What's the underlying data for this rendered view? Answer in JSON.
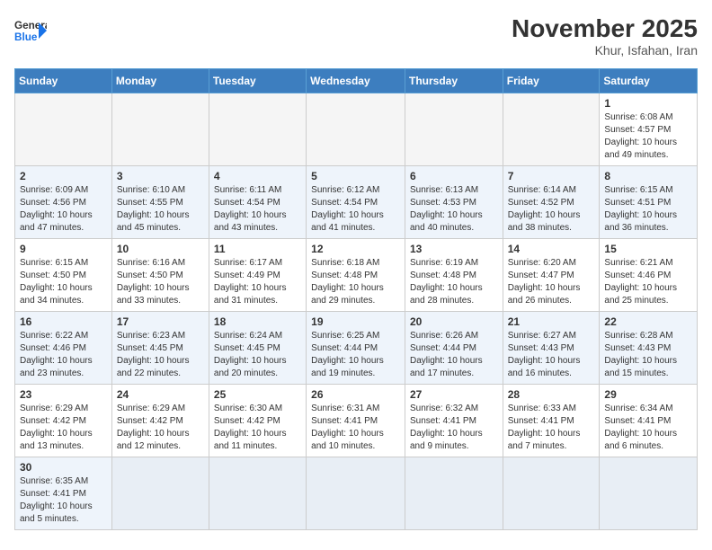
{
  "header": {
    "logo_general": "General",
    "logo_blue": "Blue",
    "month_year": "November 2025",
    "location": "Khur, Isfahan, Iran"
  },
  "days_of_week": [
    "Sunday",
    "Monday",
    "Tuesday",
    "Wednesday",
    "Thursday",
    "Friday",
    "Saturday"
  ],
  "weeks": [
    [
      {
        "day": "",
        "info": ""
      },
      {
        "day": "",
        "info": ""
      },
      {
        "day": "",
        "info": ""
      },
      {
        "day": "",
        "info": ""
      },
      {
        "day": "",
        "info": ""
      },
      {
        "day": "",
        "info": ""
      },
      {
        "day": "1",
        "info": "Sunrise: 6:08 AM\nSunset: 4:57 PM\nDaylight: 10 hours and 49 minutes."
      }
    ],
    [
      {
        "day": "2",
        "info": "Sunrise: 6:09 AM\nSunset: 4:56 PM\nDaylight: 10 hours and 47 minutes."
      },
      {
        "day": "3",
        "info": "Sunrise: 6:10 AM\nSunset: 4:55 PM\nDaylight: 10 hours and 45 minutes."
      },
      {
        "day": "4",
        "info": "Sunrise: 6:11 AM\nSunset: 4:54 PM\nDaylight: 10 hours and 43 minutes."
      },
      {
        "day": "5",
        "info": "Sunrise: 6:12 AM\nSunset: 4:54 PM\nDaylight: 10 hours and 41 minutes."
      },
      {
        "day": "6",
        "info": "Sunrise: 6:13 AM\nSunset: 4:53 PM\nDaylight: 10 hours and 40 minutes."
      },
      {
        "day": "7",
        "info": "Sunrise: 6:14 AM\nSunset: 4:52 PM\nDaylight: 10 hours and 38 minutes."
      },
      {
        "day": "8",
        "info": "Sunrise: 6:15 AM\nSunset: 4:51 PM\nDaylight: 10 hours and 36 minutes."
      }
    ],
    [
      {
        "day": "9",
        "info": "Sunrise: 6:15 AM\nSunset: 4:50 PM\nDaylight: 10 hours and 34 minutes."
      },
      {
        "day": "10",
        "info": "Sunrise: 6:16 AM\nSunset: 4:50 PM\nDaylight: 10 hours and 33 minutes."
      },
      {
        "day": "11",
        "info": "Sunrise: 6:17 AM\nSunset: 4:49 PM\nDaylight: 10 hours and 31 minutes."
      },
      {
        "day": "12",
        "info": "Sunrise: 6:18 AM\nSunset: 4:48 PM\nDaylight: 10 hours and 29 minutes."
      },
      {
        "day": "13",
        "info": "Sunrise: 6:19 AM\nSunset: 4:48 PM\nDaylight: 10 hours and 28 minutes."
      },
      {
        "day": "14",
        "info": "Sunrise: 6:20 AM\nSunset: 4:47 PM\nDaylight: 10 hours and 26 minutes."
      },
      {
        "day": "15",
        "info": "Sunrise: 6:21 AM\nSunset: 4:46 PM\nDaylight: 10 hours and 25 minutes."
      }
    ],
    [
      {
        "day": "16",
        "info": "Sunrise: 6:22 AM\nSunset: 4:46 PM\nDaylight: 10 hours and 23 minutes."
      },
      {
        "day": "17",
        "info": "Sunrise: 6:23 AM\nSunset: 4:45 PM\nDaylight: 10 hours and 22 minutes."
      },
      {
        "day": "18",
        "info": "Sunrise: 6:24 AM\nSunset: 4:45 PM\nDaylight: 10 hours and 20 minutes."
      },
      {
        "day": "19",
        "info": "Sunrise: 6:25 AM\nSunset: 4:44 PM\nDaylight: 10 hours and 19 minutes."
      },
      {
        "day": "20",
        "info": "Sunrise: 6:26 AM\nSunset: 4:44 PM\nDaylight: 10 hours and 17 minutes."
      },
      {
        "day": "21",
        "info": "Sunrise: 6:27 AM\nSunset: 4:43 PM\nDaylight: 10 hours and 16 minutes."
      },
      {
        "day": "22",
        "info": "Sunrise: 6:28 AM\nSunset: 4:43 PM\nDaylight: 10 hours and 15 minutes."
      }
    ],
    [
      {
        "day": "23",
        "info": "Sunrise: 6:29 AM\nSunset: 4:42 PM\nDaylight: 10 hours and 13 minutes."
      },
      {
        "day": "24",
        "info": "Sunrise: 6:29 AM\nSunset: 4:42 PM\nDaylight: 10 hours and 12 minutes."
      },
      {
        "day": "25",
        "info": "Sunrise: 6:30 AM\nSunset: 4:42 PM\nDaylight: 10 hours and 11 minutes."
      },
      {
        "day": "26",
        "info": "Sunrise: 6:31 AM\nSunset: 4:41 PM\nDaylight: 10 hours and 10 minutes."
      },
      {
        "day": "27",
        "info": "Sunrise: 6:32 AM\nSunset: 4:41 PM\nDaylight: 10 hours and 9 minutes."
      },
      {
        "day": "28",
        "info": "Sunrise: 6:33 AM\nSunset: 4:41 PM\nDaylight: 10 hours and 7 minutes."
      },
      {
        "day": "29",
        "info": "Sunrise: 6:34 AM\nSunset: 4:41 PM\nDaylight: 10 hours and 6 minutes."
      }
    ],
    [
      {
        "day": "30",
        "info": "Sunrise: 6:35 AM\nSunset: 4:41 PM\nDaylight: 10 hours and 5 minutes."
      },
      {
        "day": "",
        "info": ""
      },
      {
        "day": "",
        "info": ""
      },
      {
        "day": "",
        "info": ""
      },
      {
        "day": "",
        "info": ""
      },
      {
        "day": "",
        "info": ""
      },
      {
        "day": "",
        "info": ""
      }
    ]
  ]
}
